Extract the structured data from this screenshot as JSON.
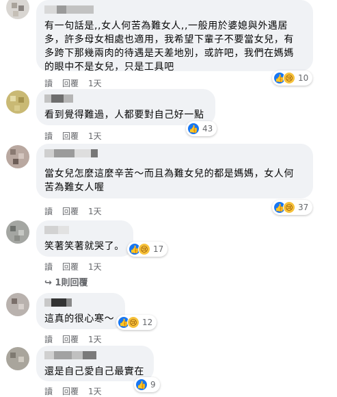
{
  "comments": [
    {
      "text": "有一句話是,,女人何苦為難女人,,一般用於婆媳與外遇居\n多，許多母女相處也適用，我希望下輩子不要當女兒，有\n多跨下那幾兩肉的待遇是天差地別，或許吧，我們在媽媽\n的眼中不是女兒，只是工具吧",
      "count": "10"
    },
    {
      "text": "看到覺得難過，人都要對自己好一點",
      "count": "43"
    },
    {
      "text": "當女兒怎麼這麼辛苦～而且為難女兒的都是媽媽，女人何\n苦為難女人喔",
      "count": "37"
    },
    {
      "text": "笑著笑著就哭了。",
      "count": "17"
    },
    {
      "text": "這真的很心寒～",
      "count": "12"
    },
    {
      "text": "還是自己愛自己最實在",
      "count": "9"
    }
  ],
  "actions": {
    "read": "讀",
    "reply": "回覆",
    "time": "1天"
  },
  "replies_link": "↪ 1則回覆",
  "icons": {
    "like": "like-icon",
    "sad": "sad-icon",
    "reply_arrow": "reply-arrow-icon"
  },
  "colors": {
    "bubble": "#f0f2f5",
    "meta": "#65676b",
    "like": "#1877f2",
    "sad": "#f7c23b"
  }
}
